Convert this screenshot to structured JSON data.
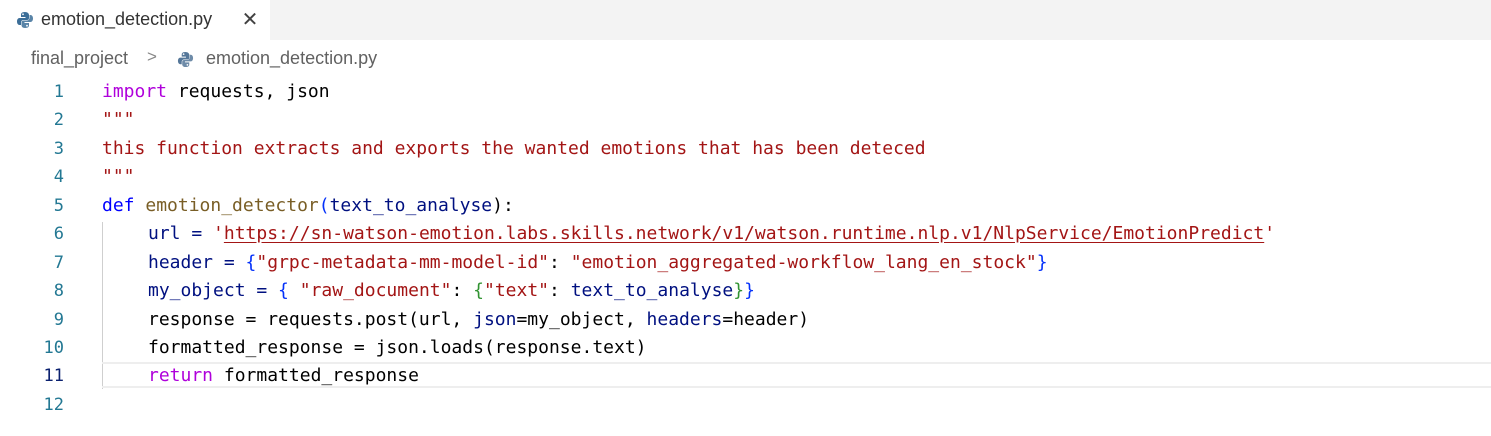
{
  "tab": {
    "title": "emotion_detection.py",
    "close_glyph": "✕",
    "icon": "python-icon"
  },
  "breadcrumb": {
    "folder": "final_project",
    "separator": ">",
    "file": "emotion_detection.py",
    "icon": "python-icon"
  },
  "editor": {
    "active_line": "11",
    "line_numbers": [
      "1",
      "2",
      "3",
      "4",
      "5",
      "6",
      "7",
      "8",
      "9",
      "10",
      "11",
      "12"
    ],
    "lines": {
      "l1": {
        "kw": "import",
        "rest": " requests, json"
      },
      "l2": {
        "text": "\"\"\""
      },
      "l3": {
        "text": "this function extracts and exports the wanted emotions that has been deteced"
      },
      "l4": {
        "text": "\"\"\""
      },
      "l5": {
        "kw": "def",
        "fn": "emotion_detector",
        "open": "(",
        "param": "text_to_analyse",
        "close": "):"
      },
      "l6": {
        "var": "url = ",
        "q1": "'",
        "url": "https://sn-watson-emotion.labs.skills.network/v1/watson.runtime.nlp.v1/NlpService/EmotionPredict",
        "q2": "'"
      },
      "l7": {
        "var": "header = ",
        "open": "{",
        "key": "\"grpc-metadata-mm-model-id\"",
        "colon": ": ",
        "value": "\"emotion_aggregated-workflow_lang_en_stock\"",
        "close": "}"
      },
      "l8": {
        "var": "my_object = ",
        "open": "{",
        "space": " ",
        "key": "\"raw_document\"",
        "colon": ": ",
        "open2": "{",
        "key2": "\"text\"",
        "colon2": ": ",
        "value": "text_to_analyse",
        "close2": "}",
        "close": "}"
      },
      "l9": {
        "var": "response = requests.post(url, ",
        "kw1": "json",
        "mid": "=my_object, ",
        "kw2": "headers",
        "end": "=header)"
      },
      "l10": {
        "text": "formatted_response = json.loads(response.text)"
      },
      "l11": {
        "kw": "return",
        "rest": " formatted_response"
      },
      "l12": {
        "text": ""
      }
    }
  },
  "colors": {
    "keyword": "#af00db",
    "string": "#a31515",
    "function": "#795e26",
    "parameter": "#001080",
    "line_number": "#237893",
    "def": "#0000ff"
  }
}
